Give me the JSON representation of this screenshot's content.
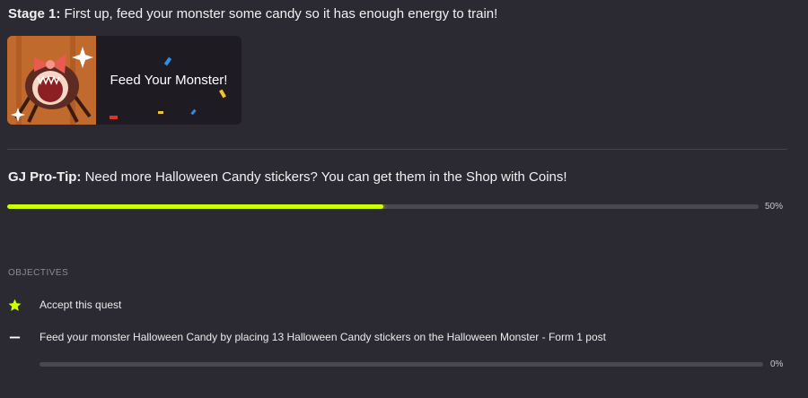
{
  "stage": {
    "label": "Stage 1:",
    "text": "First up, feed your monster some candy so it has enough energy to train!"
  },
  "feed_card": {
    "label": "Feed Your Monster!",
    "image_icon": "halloween-monster-image"
  },
  "protip": {
    "label": "GJ Pro-Tip:",
    "text": "Need more Halloween Candy stickers? You can get them in the Shop with Coins!"
  },
  "quest_progress": {
    "percent_text": "50%",
    "value": 0.5,
    "color": "#ccff00"
  },
  "objectives": {
    "heading": "OBJECTIVES",
    "items": [
      {
        "icon": "star-icon",
        "text": "Accept this quest",
        "completed": true
      },
      {
        "icon": "dash-icon",
        "text": "Feed your monster Halloween Candy by placing 13 Halloween Candy stickers on the Halloween Monster - Form 1 post",
        "completed": false,
        "progress_text": "0%",
        "progress_value": 0
      }
    ]
  },
  "colors": {
    "background": "#2b2932",
    "accent": "#ccff00",
    "track": "#4a4750"
  }
}
